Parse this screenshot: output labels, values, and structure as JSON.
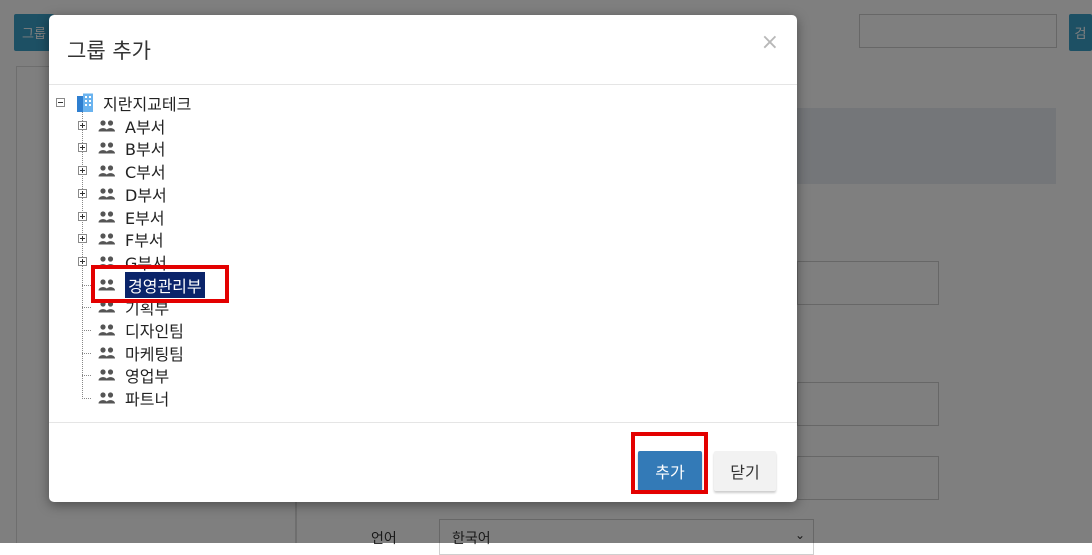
{
  "background": {
    "group_button_label": "그룹",
    "search_button_label": "검",
    "language_label": "언어",
    "language_value": "한국어"
  },
  "modal": {
    "title": "그룹 추가",
    "close_icon": "×",
    "tree": {
      "root": {
        "label": "지란지교테크",
        "icon": "building-icon"
      },
      "children": [
        {
          "label": "A부서",
          "icon": "users-icon",
          "expandable": true
        },
        {
          "label": "B부서",
          "icon": "users-icon",
          "expandable": true
        },
        {
          "label": "C부서",
          "icon": "users-icon",
          "expandable": true
        },
        {
          "label": "D부서",
          "icon": "users-icon",
          "expandable": true
        },
        {
          "label": "E부서",
          "icon": "users-icon",
          "expandable": true
        },
        {
          "label": "F부서",
          "icon": "users-icon",
          "expandable": true
        },
        {
          "label": "G부서",
          "icon": "users-icon",
          "expandable": true
        },
        {
          "label": "경영관리부",
          "icon": "users-icon",
          "expandable": false,
          "selected": true
        },
        {
          "label": "기획부",
          "icon": "users-icon",
          "expandable": false
        },
        {
          "label": "디자인팀",
          "icon": "users-icon",
          "expandable": false
        },
        {
          "label": "마케팅팀",
          "icon": "users-icon",
          "expandable": false
        },
        {
          "label": "영업부",
          "icon": "users-icon",
          "expandable": false
        },
        {
          "label": "파트너",
          "icon": "users-icon",
          "expandable": false
        }
      ]
    },
    "footer": {
      "add_label": "추가",
      "close_label": "닫기"
    }
  },
  "colors": {
    "primary": "#337ab7",
    "selection": "#0a246a",
    "highlight": "#e30000"
  }
}
